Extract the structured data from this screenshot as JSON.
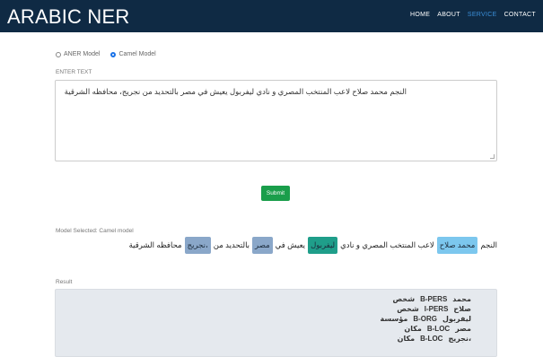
{
  "navbar": {
    "brand": "ARABIC NER",
    "links": [
      {
        "label": "HOME",
        "active": false
      },
      {
        "label": "ABOUT",
        "active": false
      },
      {
        "label": "SERVICE",
        "active": true
      },
      {
        "label": "CONTACT",
        "active": false
      }
    ],
    "bg_color": "#0f2a44",
    "active_color": "#3b8fd9"
  },
  "models": {
    "options": [
      {
        "label": "ANER Model",
        "selected": false
      },
      {
        "label": "Camel Model",
        "selected": true
      }
    ]
  },
  "input": {
    "label": "ENTER TEXT",
    "value": "النجم محمد صلاح لاعب المنتخب المصري و نادي ليفربول يعيش في مصر بالتحديد من نجريج، محافظه الشرقية"
  },
  "submit_label": "Submit",
  "model_selected_label": "Model Selected: Camel model",
  "tagged_tokens": [
    {
      "text": "النجم",
      "entity": null
    },
    {
      "text": "محمد صلاح",
      "entity": "PERS"
    },
    {
      "text": "لاعب المنتخب المصري و نادي",
      "entity": null
    },
    {
      "text": "ليفربول",
      "entity": "ORG"
    },
    {
      "text": "يعيش في",
      "entity": null
    },
    {
      "text": "مصر",
      "entity": "LOC"
    },
    {
      "text": "بالتحديد من",
      "entity": null
    },
    {
      "text": "نجريج،",
      "entity": "LOC"
    },
    {
      "text": "محافظه الشرقية",
      "entity": null
    }
  ],
  "entity_colors": {
    "PERS": "#7cc7ee",
    "ORG": "#1f9e8a",
    "LOC": "#8aa7c9"
  },
  "result_label": "Result",
  "result_rows": [
    {
      "word": "محمد",
      "tag": "B-PERS",
      "type": "شخص"
    },
    {
      "word": "صلاح",
      "tag": "I-PERS",
      "type": "شخص"
    },
    {
      "word": "ليفربول",
      "tag": "B-ORG",
      "type": "مؤسسة"
    },
    {
      "word": "مصر",
      "tag": "B-LOC",
      "type": "مكان"
    },
    {
      "word": "نجريج،",
      "tag": "B-LOC",
      "type": "مكان"
    }
  ]
}
